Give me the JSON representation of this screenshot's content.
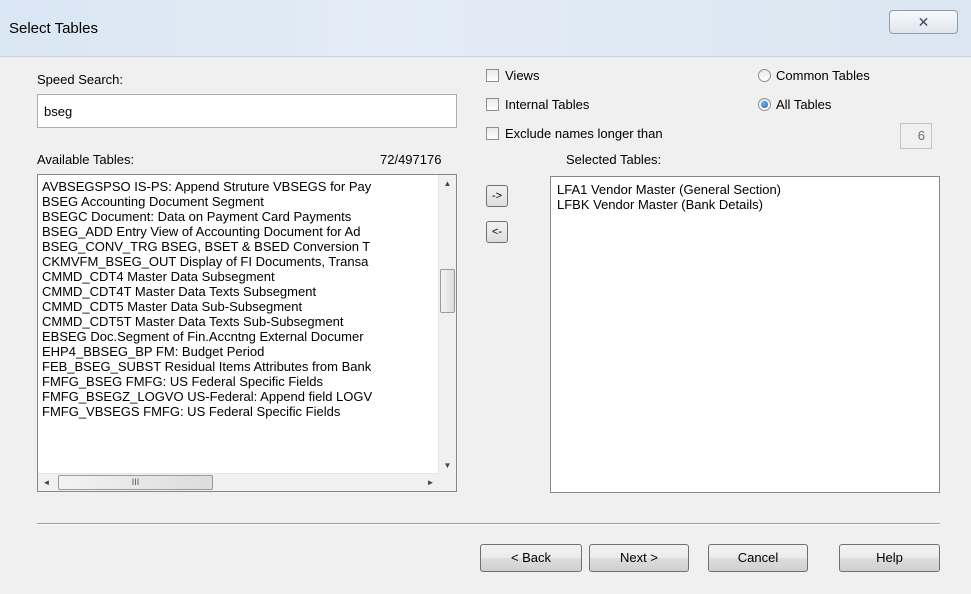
{
  "window": {
    "title": "Select Tables",
    "close_symbol": "✕"
  },
  "search": {
    "label": "Speed Search:",
    "value": "bseg"
  },
  "available": {
    "label": "Available Tables:",
    "count": "72/497176",
    "items": [
      "AVBSEGSPSO IS-PS: Append Struture VBSEGS for Pay",
      "BSEG Accounting Document Segment",
      "BSEGC Document: Data on Payment Card Payments",
      "BSEG_ADD Entry View of Accounting Document for Ad",
      "BSEG_CONV_TRG BSEG, BSET & BSED Conversion T",
      "CKMVFM_BSEG_OUT Display of FI Documents, Transa",
      "CMMD_CDT4 Master Data Subsegment",
      "CMMD_CDT4T Master Data Texts Subsegment",
      "CMMD_CDT5 Master Data Sub-Subsegment",
      "CMMD_CDT5T Master Data Texts Sub-Subsegment",
      "EBSEG Doc.Segment of Fin.Accntng External Documer",
      "EHP4_BBSEG_BP FM: Budget Period",
      "FEB_BSEG_SUBST Residual Items Attributes from Bank",
      "FMFG_BSEG FMFG: US Federal Specific Fields",
      "FMFG_BSEGZ_LOGVO US-Federal: Append field LOGV",
      "FMFG_VBSEGS FMFG: US Federal Specific Fields"
    ]
  },
  "transfer": {
    "add_label": "->",
    "remove_label": "<-"
  },
  "options": {
    "views": "Views",
    "internal_tables": "Internal Tables",
    "exclude_long": "Exclude names longer than",
    "max_length": "6",
    "common_tables": "Common Tables",
    "all_tables": "All Tables",
    "selected_scope": "All Tables"
  },
  "selected": {
    "label": "Selected Tables:",
    "items": [
      "LFA1 Vendor Master (General Section)",
      "LFBK Vendor Master (Bank Details)"
    ]
  },
  "buttons": {
    "back": "< Back",
    "next": "Next >",
    "cancel": "Cancel",
    "help": "Help"
  },
  "scroll": {
    "h_thumb_grip": "III",
    "left_arrow": "◄",
    "right_arrow": "►",
    "up_arrow": "▲",
    "down_arrow": "▼"
  }
}
